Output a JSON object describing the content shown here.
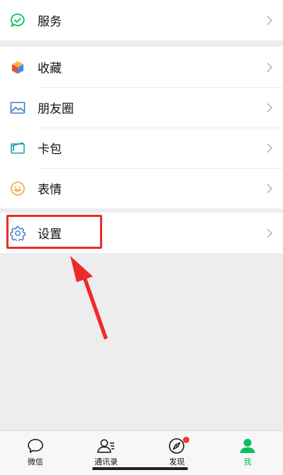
{
  "menu": {
    "services": "服务",
    "favorites": "收藏",
    "moments": "朋友圈",
    "cards": "卡包",
    "stickers": "表情",
    "settings": "设置"
  },
  "tabs": [
    {
      "label": "微信",
      "icon": "chat-icon",
      "active": false
    },
    {
      "label": "通讯录",
      "icon": "contacts-icon",
      "active": false
    },
    {
      "label": "发现",
      "icon": "compass-icon",
      "active": false,
      "badge": true
    },
    {
      "label": "我",
      "icon": "person-icon",
      "active": true
    }
  ],
  "colors": {
    "accent": "#07c160",
    "highlight": "#ef2a2a",
    "badge": "#f43530"
  }
}
